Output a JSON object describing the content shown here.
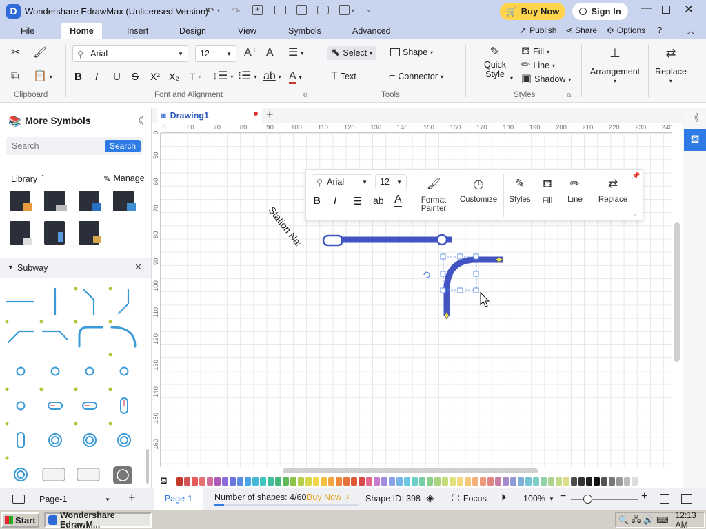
{
  "window": {
    "title": "Wondershare EdrawMax (Unlicensed Version)",
    "buy_now": "Buy Now",
    "sign_in": "Sign In"
  },
  "menu": {
    "tabs": [
      "File",
      "Home",
      "Insert",
      "Design",
      "View",
      "Symbols",
      "Advanced"
    ],
    "publish": "Publish",
    "share": "Share",
    "options": "Options"
  },
  "ribbon": {
    "font_name": "Arial",
    "font_size": "12",
    "select": "Select",
    "shape": "Shape",
    "text": "Text",
    "connector": "Connector",
    "quick_style_1": "Quick",
    "quick_style_2": "Style",
    "fill": "Fill",
    "line": "Line",
    "shadow": "Shadow",
    "arrangement": "Arrangement",
    "replace": "Replace",
    "groups": {
      "clipboard": "Clipboard",
      "font_alignment": "Font and Alignment",
      "tools": "Tools",
      "styles": "Styles"
    }
  },
  "left_panel": {
    "title": "More Symbols",
    "search_placeholder": "Search",
    "search_button": "Search",
    "library": "Library",
    "manage": "Manage",
    "subway": "Subway"
  },
  "document": {
    "tab": "Drawing1"
  },
  "ruler": {
    "h": [
      "0",
      "60",
      "70",
      "80",
      "90",
      "100",
      "110",
      "120",
      "130",
      "140",
      "150",
      "160",
      "170",
      "180",
      "190",
      "200",
      "210",
      "220",
      "230",
      "240"
    ],
    "v": [
      "0",
      "50",
      "60",
      "70",
      "80",
      "90",
      "100",
      "110",
      "120",
      "130",
      "140",
      "150",
      "160"
    ]
  },
  "canvas": {
    "station_label": "Station Name"
  },
  "float_toolbar": {
    "font_name": "Arial",
    "font_size": "12",
    "format_painter_1": "Format",
    "format_painter_2": "Painter",
    "customize": "Customize",
    "styles": "Styles",
    "fill": "Fill",
    "line": "Line",
    "replace": "Replace"
  },
  "status": {
    "page_select": "Page-1",
    "page_tab": "Page-1",
    "shape_count": "Number of shapes: 4/60",
    "buy_now": "Buy Now",
    "shape_id": "Shape ID: 398",
    "focus": "Focus",
    "zoom": "100%",
    "shape_progress": 0.067
  },
  "taskbar": {
    "start": "Start",
    "app": "Wondershare EdrawM...",
    "time": "12:13 AM"
  },
  "colors": {
    "accent": "#4154c2",
    "title_bg": "#c9d4ef",
    "buy_now_bg": "#ffd44d",
    "palette": [
      "#c0392b",
      "#d35454",
      "#e55a5a",
      "#e57373",
      "#d16f9a",
      "#b05ab8",
      "#8e6ad8",
      "#6a76e0",
      "#5b8de5",
      "#4aa6e8",
      "#45b7d8",
      "#3fc4c0",
      "#3fbfa0",
      "#48b87a",
      "#5fbb55",
      "#8bc34a",
      "#b5cf4a",
      "#d6d84a",
      "#f2d64b",
      "#f4c042",
      "#f2a541",
      "#ef8a3d",
      "#e8703a",
      "#de5a36",
      "#d94b4b",
      "#e36a8e",
      "#c77dcf",
      "#a38ce0",
      "#8aa0e8",
      "#77b4ea",
      "#6cc6e3",
      "#6fd0c8",
      "#78cfa7",
      "#8bd08a",
      "#a8d47d",
      "#c6dc7a",
      "#e2e07a",
      "#f3d97e",
      "#f4c77a",
      "#f2b07a",
      "#eb9a7d",
      "#e0857f",
      "#c97fa6",
      "#a78ac9",
      "#8e9ad6",
      "#7fb0db",
      "#77c3d6",
      "#7ccfc2",
      "#90d2a6",
      "#aad692",
      "#c4db8b",
      "#dcdc8a",
      "#4d4d4d",
      "#333333",
      "#1f1f1f",
      "#111111",
      "#555555",
      "#777777",
      "#999999",
      "#bbbbbb",
      "#dddddd"
    ]
  }
}
